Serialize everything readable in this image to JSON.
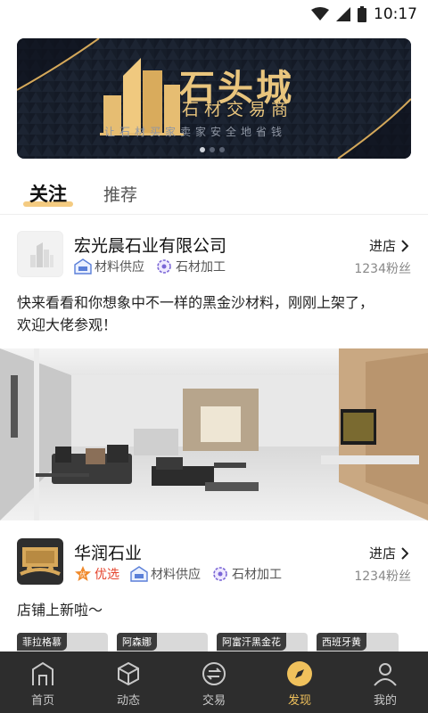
{
  "status": {
    "time": "10:17"
  },
  "banner": {
    "title": "石头城",
    "subtitle": "石材交易商",
    "slogan": "让石材买家卖家安全地省钱",
    "dots": 3,
    "active_dot": 0
  },
  "tabs": [
    {
      "label": "关注",
      "active": true
    },
    {
      "label": "推荐",
      "active": false
    }
  ],
  "posts": [
    {
      "shop_name": "宏光晨石业有限公司",
      "tags": [
        "材料供应",
        "石材加工"
      ],
      "enter_label": "进店",
      "fans": "1234粉丝",
      "text_line1": "快来看看和你想象中不一样的黑金沙材料，刚刚上架了，",
      "text_line2": "欢迎大佬参观！"
    },
    {
      "shop_name": "华润石业",
      "preferred": "优选",
      "tags": [
        "材料供应",
        "石材加工"
      ],
      "enter_label": "进店",
      "fans": "1234粉丝",
      "text_line1": "店铺上新啦～"
    }
  ],
  "products": [
    {
      "label": "菲拉格慕"
    },
    {
      "label": "阿森娜"
    },
    {
      "label": "阿富汗黑金花"
    },
    {
      "label": "西班牙黄"
    }
  ],
  "nav": [
    {
      "label": "首页",
      "icon": "home-icon",
      "active": false
    },
    {
      "label": "动态",
      "icon": "cube-icon",
      "active": false
    },
    {
      "label": "交易",
      "icon": "exchange-icon",
      "active": false
    },
    {
      "label": "发现",
      "icon": "compass-icon",
      "active": true
    },
    {
      "label": "我的",
      "icon": "user-icon",
      "active": false
    }
  ],
  "colors": {
    "accent": "#f0c15c",
    "banner_gold": "#e9c57d",
    "nav_bg": "#2d2d2d",
    "preferred_red": "#e5452e"
  }
}
